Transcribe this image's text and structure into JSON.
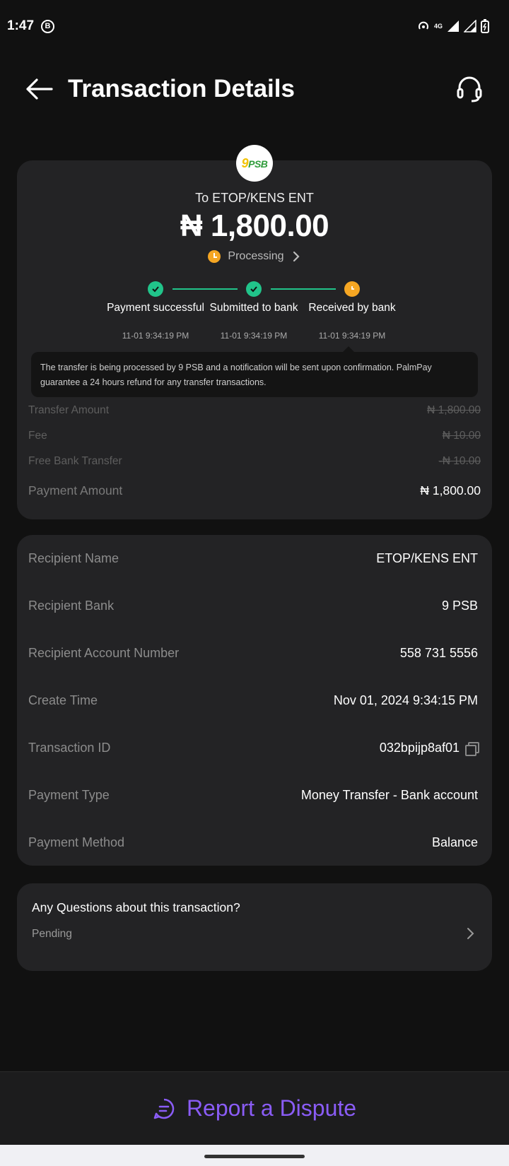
{
  "status_bar": {
    "time": "1:47",
    "b_badge": "B",
    "network": "4G"
  },
  "header": {
    "title": "Transaction Details"
  },
  "transaction": {
    "recipient_line": "To ETOP/KENS ENT",
    "amount": "₦ 1,800.00",
    "status": "Processing",
    "logo_text_nine": "9",
    "logo_text_psb": "PSB"
  },
  "steps": [
    {
      "label": "Payment successful",
      "time": "11-01 9:34:19 PM",
      "state": "done"
    },
    {
      "label": "Submitted to bank",
      "time": "11-01 9:34:19 PM",
      "state": "done"
    },
    {
      "label": "Received by bank",
      "time": "11-01 9:34:19 PM",
      "state": "pending"
    }
  ],
  "notice": "The transfer is being processed by 9 PSB and a notification will be sent upon confirmation. PalmPay guarantee a 24 hours refund for any transfer transactions.",
  "fees": {
    "transfer_amount_label": "Transfer Amount",
    "transfer_amount_value": "₦ 1,800.00",
    "fee_label": "Fee",
    "fee_value": "₦ 10.00",
    "free_label": "Free Bank Transfer",
    "free_value": "-₦ 10.00",
    "payment_amount_label": "Payment Amount",
    "payment_amount_value": "₦ 1,800.00"
  },
  "details": {
    "recipient_name_label": "Recipient Name",
    "recipient_name": "ETOP/KENS ENT",
    "recipient_bank_label": "Recipient Bank",
    "recipient_bank": "9 PSB",
    "account_number_label": "Recipient Account Number",
    "account_number": "558 731 5556",
    "create_time_label": "Create Time",
    "create_time": "Nov 01, 2024 9:34:15 PM",
    "transaction_id_label": "Transaction ID",
    "transaction_id": "032bpijp8af01",
    "payment_type_label": "Payment Type",
    "payment_type": "Money Transfer - Bank account",
    "payment_method_label": "Payment Method",
    "payment_method": "Balance"
  },
  "questions": {
    "title": "Any Questions about this transaction?",
    "status": "Pending"
  },
  "footer": {
    "dispute_label": "Report a Dispute"
  },
  "colors": {
    "accent": "#8a5cf6",
    "success": "#21c48a",
    "pending": "#f5a623",
    "card": "#232325",
    "background": "#111111"
  }
}
